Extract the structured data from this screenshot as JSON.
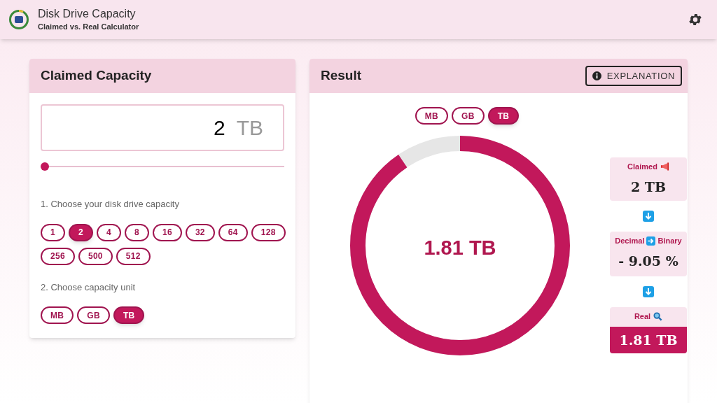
{
  "app_bar": {
    "title": "Disk Drive Capacity",
    "subtitle": "Claimed vs. Real Calculator"
  },
  "claimed": {
    "title": "Claimed Capacity",
    "value": "2",
    "unit": "TB",
    "capacity_label": "1. Choose your disk drive capacity",
    "capacities": [
      {
        "label": "1",
        "selected": false
      },
      {
        "label": "2",
        "selected": true
      },
      {
        "label": "4",
        "selected": false
      },
      {
        "label": "8",
        "selected": false
      },
      {
        "label": "16",
        "selected": false
      },
      {
        "label": "32",
        "selected": false
      },
      {
        "label": "64",
        "selected": false
      },
      {
        "label": "128",
        "selected": false
      },
      {
        "label": "256",
        "selected": false
      },
      {
        "label": "500",
        "selected": false
      },
      {
        "label": "512",
        "selected": false
      }
    ],
    "unit_label": "2. Choose capacity unit",
    "units": [
      {
        "label": "MB",
        "selected": false
      },
      {
        "label": "GB",
        "selected": false
      },
      {
        "label": "TB",
        "selected": true
      }
    ]
  },
  "result": {
    "title": "Result",
    "explanation_button": "EXPLANATION",
    "units": [
      {
        "label": "MB",
        "selected": false
      },
      {
        "label": "GB",
        "selected": false
      },
      {
        "label": "TB",
        "selected": true
      }
    ],
    "gauge": {
      "center_text": "1.81 TB"
    },
    "steps": [
      {
        "kind": "plain",
        "label": "Claimed",
        "value": "2 TB"
      },
      {
        "kind": "conversion",
        "label_left": "Decimal",
        "label_right": "Binary",
        "value": "- 9.05 %"
      },
      {
        "kind": "highlight",
        "label": "Real",
        "value": "1.81 TB"
      }
    ]
  }
}
